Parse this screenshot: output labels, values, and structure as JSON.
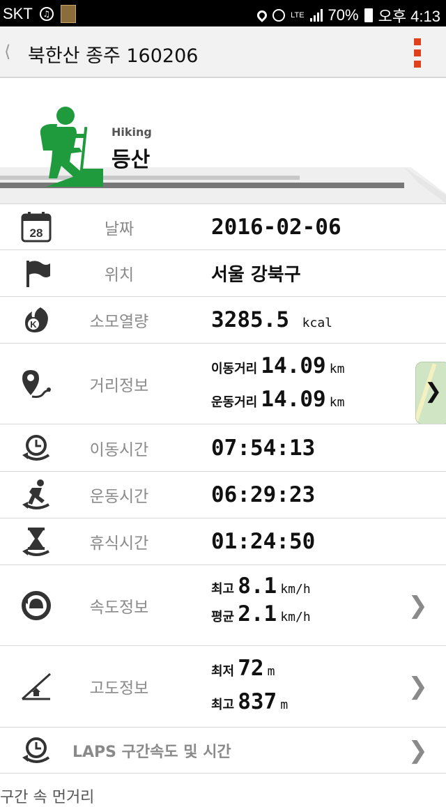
{
  "status": {
    "carrier": "SKT",
    "network": "LTE",
    "battery": "70%",
    "time": "오후 4:13",
    "icons": [
      "music-icon",
      "thumbnail-icon",
      "location-icon",
      "alarm-icon",
      "lte-icon",
      "signal-icon",
      "battery-icon"
    ]
  },
  "header": {
    "back_icon": "back-chevron-icon",
    "title": "북한산 종주 160206",
    "menu_icon": "more-vertical-icon",
    "accent": "#e0411c"
  },
  "activity": {
    "sub_label": "Hiking",
    "title": "등산",
    "icon": "hiker-icon",
    "color": "#1f9a3c"
  },
  "rows": {
    "date": {
      "icon": "calendar-icon",
      "icon_text": "28",
      "label": "날짜",
      "value": "2016-02-06"
    },
    "location": {
      "icon": "flag-icon",
      "label": "위치",
      "value": "서울  강북구"
    },
    "calories": {
      "icon": "calorie-icon",
      "label": "소모열량",
      "value": "3285.5",
      "unit": "kcal"
    },
    "distance": {
      "icon": "route-pin-icon",
      "label": "거리정보",
      "move_tag": "이동거리",
      "move_value": "14.09",
      "move_unit": "km",
      "exercise_tag": "운동거리",
      "exercise_value": "14.09",
      "exercise_unit": "km",
      "map_icon": "map-thumbnail-icon"
    },
    "move_time": {
      "icon": "clock-return-icon",
      "label": "이동시간",
      "value": "07:54:13"
    },
    "exercise_time": {
      "icon": "runner-icon",
      "label": "운동시간",
      "value": "06:29:23"
    },
    "rest_time": {
      "icon": "hourglass-icon",
      "label": "휴식시간",
      "value": "01:24:50"
    },
    "speed": {
      "icon": "speedometer-icon",
      "label": "속도정보",
      "max_tag": "최고",
      "max_value": "8.1",
      "max_unit": "km/h",
      "avg_tag": "평균",
      "avg_value": "2.1",
      "avg_unit": "km/h"
    },
    "altitude": {
      "icon": "altitude-icon",
      "label": "고도정보",
      "min_tag": "최저",
      "min_value": "72",
      "min_unit": "m",
      "max_tag": "최고",
      "max_value": "837",
      "max_unit": "m"
    },
    "laps": {
      "icon": "laps-clock-icon",
      "label": "LAPS 구간속도 및 시간"
    }
  },
  "footer_partial_text": "구간 속 먼거리"
}
